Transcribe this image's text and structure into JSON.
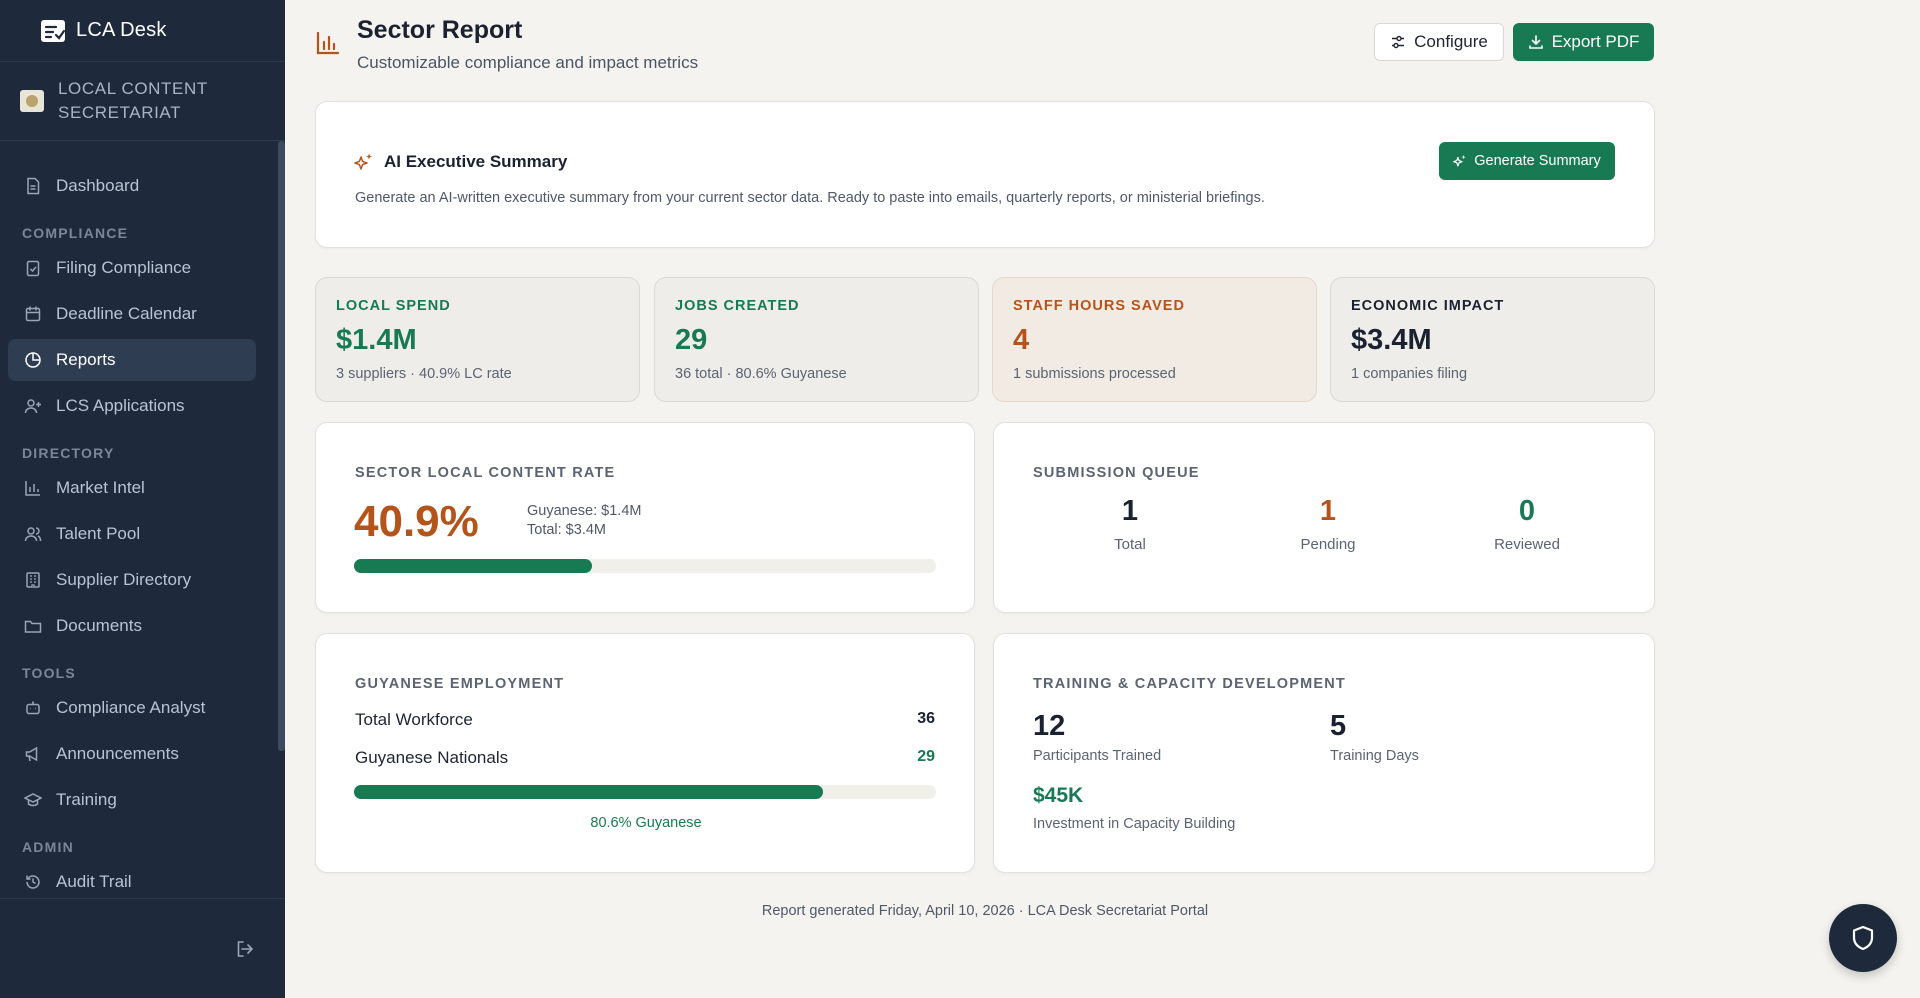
{
  "brand": {
    "name": "LCA Desk"
  },
  "org": {
    "name": "LOCAL CONTENT SECRETARIAT"
  },
  "nav": {
    "dashboard": "Dashboard",
    "section_compliance": "COMPLIANCE",
    "filing": "Filing Compliance",
    "deadline": "Deadline Calendar",
    "reports": "Reports",
    "lcs": "LCS Applications",
    "section_directory": "DIRECTORY",
    "market": "Market Intel",
    "talent": "Talent Pool",
    "supplier": "Supplier Directory",
    "documents": "Documents",
    "section_tools": "TOOLS",
    "analyst": "Compliance Analyst",
    "announcements": "Announcements",
    "training": "Training",
    "section_admin": "ADMIN",
    "audit": "Audit Trail"
  },
  "header": {
    "title": "Sector Report",
    "subtitle": "Customizable compliance and impact metrics",
    "configure_label": "Configure",
    "export_label": "Export PDF"
  },
  "ai_summary": {
    "title": "AI Executive Summary",
    "description": "Generate an AI-written executive summary from your current sector data. Ready to paste into emails, quarterly reports, or ministerial briefings.",
    "button_label": "Generate Summary"
  },
  "stats": [
    {
      "label": "LOCAL SPEND",
      "value": "$1.4M",
      "sub": "3 suppliers · 40.9% LC rate",
      "color": "#177a52"
    },
    {
      "label": "JOBS CREATED",
      "value": "29",
      "sub": "36 total · 80.6% Guyanese",
      "color": "#177a52"
    },
    {
      "label": "STAFF HOURS SAVED",
      "value": "4",
      "sub": "1 submissions processed",
      "color": "#b5541a"
    },
    {
      "label": "ECONOMIC IMPACT",
      "value": "$3.4M",
      "sub": "1 companies filing",
      "color": "#1a2130"
    }
  ],
  "lc_rate": {
    "label": "SECTOR LOCAL CONTENT RATE",
    "value": "40.9%",
    "guyanese": "Guyanese: $1.4M",
    "total": "Total: $3.4M",
    "fraction": 0.409
  },
  "queue": {
    "label": "SUBMISSION QUEUE",
    "items": [
      {
        "num": "1",
        "label": "Total",
        "color": "#1a2130"
      },
      {
        "num": "1",
        "label": "Pending",
        "color": "#b5541a"
      },
      {
        "num": "0",
        "label": "Reviewed",
        "color": "#177a52"
      }
    ]
  },
  "employment": {
    "label": "GUYANESE EMPLOYMENT",
    "workforce_label": "Total Workforce",
    "workforce_value": "36",
    "nationals_label": "Guyanese Nationals",
    "nationals_value": "29",
    "percent_label": "80.6% Guyanese",
    "fraction": 0.806
  },
  "training": {
    "label": "TRAINING & CAPACITY DEVELOPMENT",
    "participants_value": "12",
    "participants_label": "Participants Trained",
    "days_value": "5",
    "days_label": "Training Days",
    "investment_value": "$45K",
    "investment_label": "Investment in Capacity Building"
  },
  "footer": {
    "note": "Report generated Friday, April 10, 2026 · LCA Desk Secretariat Portal"
  },
  "colors": {
    "accent": "#177a52",
    "warm": "#b5541a",
    "sidebar": "#1e2a3c"
  }
}
